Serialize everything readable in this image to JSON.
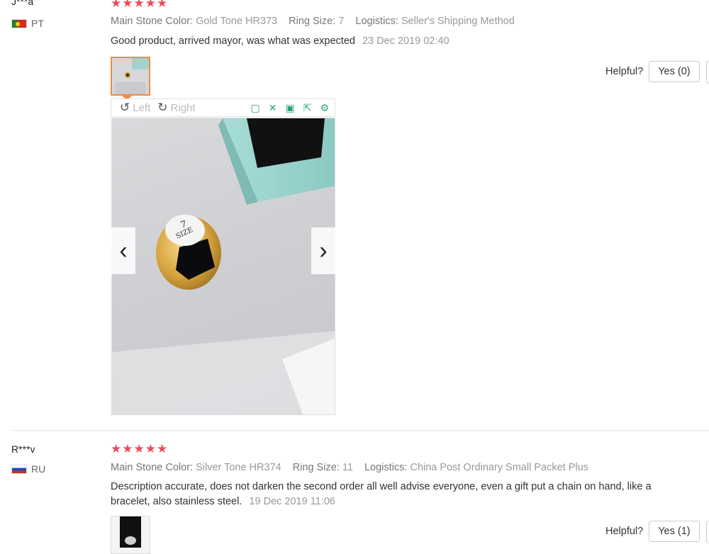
{
  "reviews": [
    {
      "user": "J***a",
      "country": "PT",
      "stars": "★★★★★",
      "attrs": [
        {
          "key": "Main Stone Color:",
          "value": "Gold Tone HR373"
        },
        {
          "key": "Ring Size:",
          "value": "7"
        },
        {
          "key": "Logistics:",
          "value": "Seller's Shipping Method"
        }
      ],
      "comment": "Good product, arrived mayor, was what was expected",
      "date": "23 Dec 2019 02:40",
      "helpful_label": "Helpful?",
      "yes_label": "Yes (0)"
    },
    {
      "user": "R***v",
      "country": "RU",
      "stars": "★★★★★",
      "attrs": [
        {
          "key": "Main Stone Color:",
          "value": "Silver Tone HR374"
        },
        {
          "key": "Ring Size:",
          "value": "11"
        },
        {
          "key": "Logistics:",
          "value": "China Post Ordinary Small Packet Plus"
        }
      ],
      "comment": "Description accurate, does not darken the second order all well advise everyone, even a gift put a chain on hand, like a bracelet, also stainless steel.",
      "date": "19 Dec 2019 11:06",
      "helpful_label": "Helpful?",
      "yes_label": "Yes (1)"
    }
  ],
  "viewer": {
    "rotate_left_label": "Left",
    "rotate_right_label": "Right",
    "icons": [
      "original-size-icon",
      "fullscreen-icon",
      "save-icon",
      "share-icon",
      "settings-icon"
    ],
    "prev_label": "‹",
    "next_label": "›",
    "size_sticker_number": "7",
    "size_sticker_text": "SIZE"
  },
  "colors": {
    "star": "#ef4a56",
    "thumb_active_border": "#f08a43",
    "toolbar_icon": "#2aa37b"
  }
}
